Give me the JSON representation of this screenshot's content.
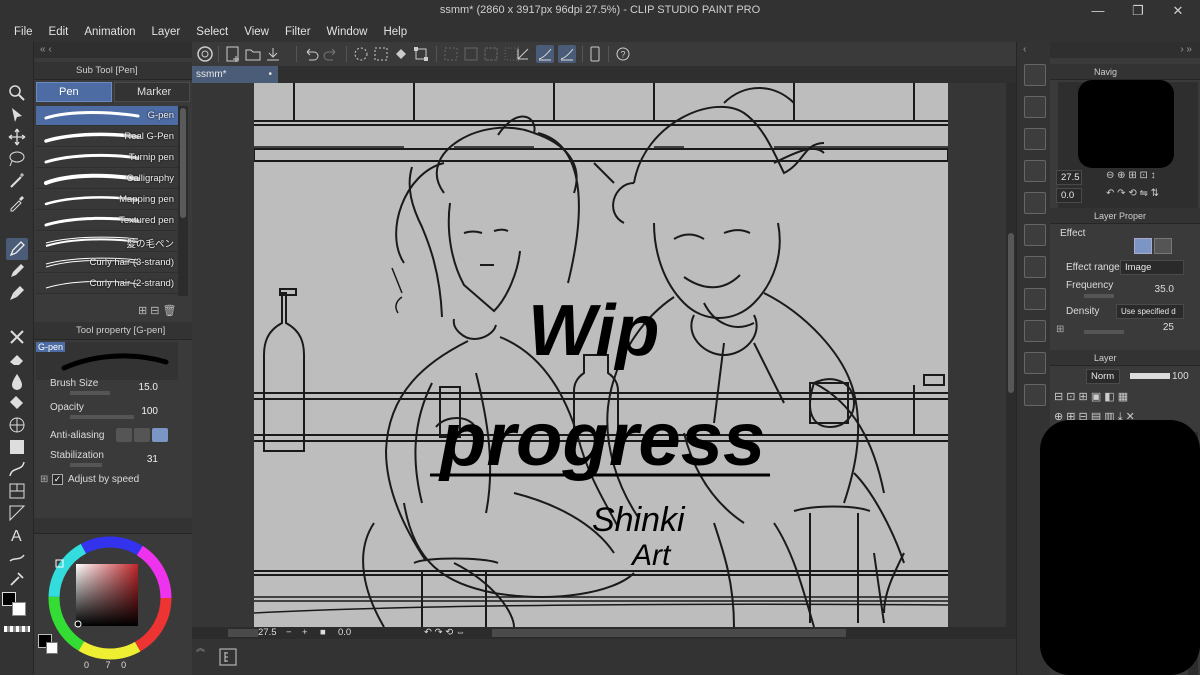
{
  "window": {
    "title": "ssmm* (2860 x 3917px 96dpi 27.5%)  - CLIP STUDIO PAINT PRO",
    "controls": [
      "—",
      "❐",
      "✕"
    ]
  },
  "menu": [
    "File",
    "Edit",
    "Animation",
    "Layer",
    "Select",
    "View",
    "Filter",
    "Window",
    "Help"
  ],
  "document_tab": {
    "name": "ssmm*",
    "modified_dot": "•"
  },
  "sub_tool": {
    "header": "Sub Tool [Pen]",
    "tabs": [
      "Pen",
      "Marker"
    ],
    "brushes": [
      "G-pen",
      "Real G-Pen",
      "Turnip pen",
      "Calligraphy",
      "Mapping pen",
      "Textured pen",
      "髪の毛ペン",
      "Curly hair (3-strand)",
      "Curly hair (2-strand)"
    ],
    "selected_brush": "G-pen"
  },
  "tool_property": {
    "header": "Tool property [G-pen]",
    "preview_label": "G-pen",
    "brush_size": {
      "label": "Brush Size",
      "value": "15.0"
    },
    "opacity": {
      "label": "Opacity",
      "value": "100"
    },
    "anti_aliasing": {
      "label": "Anti-aliasing"
    },
    "stabilization": {
      "label": "Stabilization",
      "value": "31"
    },
    "adjust_by_speed": {
      "label": "Adjust by speed",
      "checked": true
    }
  },
  "color": {
    "main": "#000000",
    "sub": "#ffffff",
    "wheel_selected": "#c0262a",
    "readouts": [
      "0",
      "7",
      "0"
    ]
  },
  "canvas_text": {
    "line1": "Wip",
    "line2": "progress",
    "signature1": "Shinki",
    "signature2": "Art"
  },
  "status": {
    "zoom": "27.5",
    "angle": "0.0"
  },
  "navigator": {
    "header": "Navig",
    "zoom": "27.5",
    "angle": "0.0"
  },
  "layer_property": {
    "header": "Layer Proper",
    "effect_label": "Effect",
    "effect_range": {
      "label": "Effect range",
      "value": "Image"
    },
    "frequency": {
      "label": "Frequency",
      "value": "35.0"
    },
    "density": {
      "label": "Density",
      "value": "Use specified d",
      "number": "25"
    }
  },
  "layer_panel": {
    "header": "Layer",
    "blend_mode": "Norm",
    "opacity": "100"
  },
  "accent": "#4d6ca3"
}
